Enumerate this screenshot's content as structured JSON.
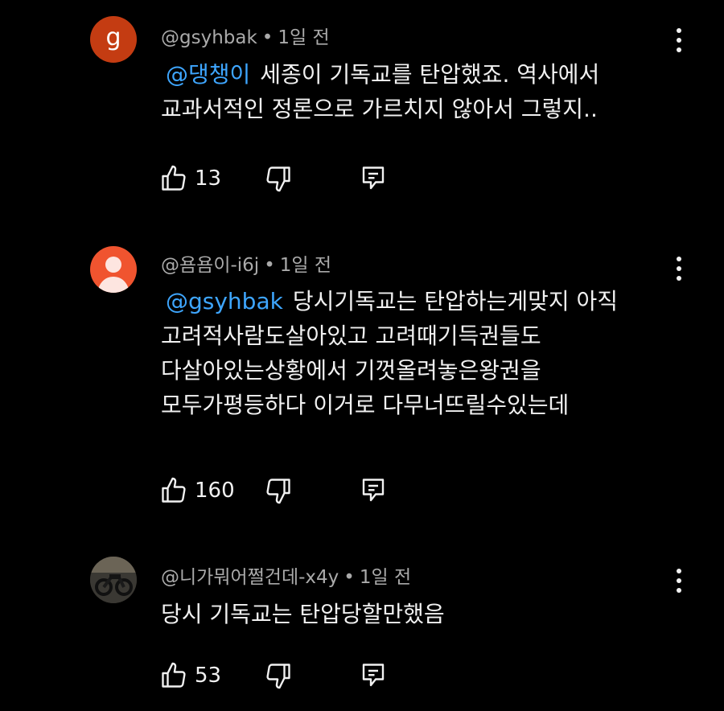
{
  "comments": [
    {
      "avatar_letter": "g",
      "author": "@gsyhbak",
      "time": "1일 전",
      "mention": "@댕챙이",
      "lines": [
        "세종이 기독교를 탄압했죠. 역사에서",
        "교과서적인 정론으로 가르치지 않아서 그렇지.."
      ],
      "likes": "13"
    },
    {
      "author": "@욤욤이-i6j",
      "time": "1일 전",
      "mention": "@gsyhbak",
      "lines": [
        "당시기독교는 탄압하는게맞지 아직",
        "고려적사람도살아있고 고려때기득권들도",
        "다살아있는상황에서 기껏올려놓은왕권을",
        "모두가평등하다 이거로 다무너뜨릴수있는데"
      ],
      "likes": "160"
    },
    {
      "author": "@니가뭐어쩔건데-x4y",
      "time": "1일 전",
      "lines": [
        "당시 기독교는 탄압당할만했음"
      ],
      "likes": "53"
    }
  ],
  "separator": "•",
  "icons": {
    "like": "thumbs-up-icon",
    "dislike": "thumbs-down-icon",
    "reply": "reply-icon",
    "more": "more-vertical-icon"
  },
  "colors": {
    "background": "#000000",
    "text": "#f1f1f1",
    "meta": "#aaaaaa",
    "mention": "#3ea6ff",
    "avatar_g": "#c43c12",
    "avatar_person": "#f0542f"
  }
}
